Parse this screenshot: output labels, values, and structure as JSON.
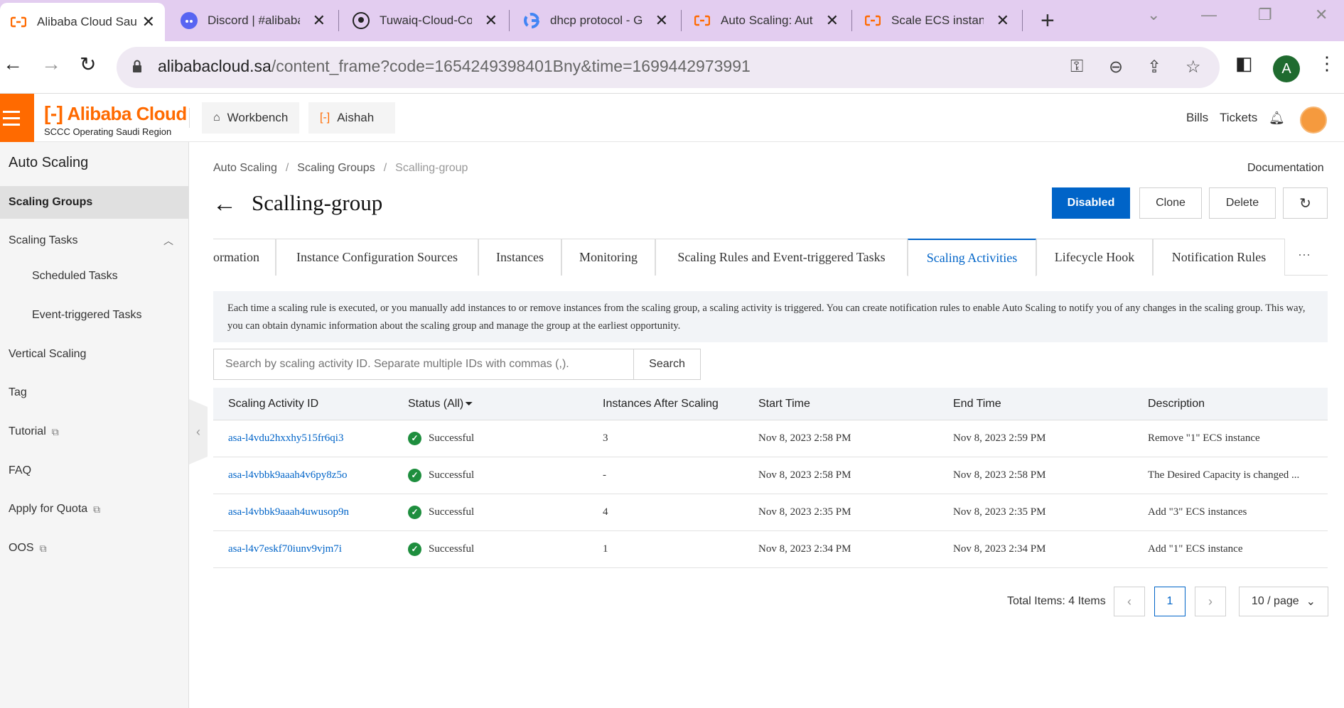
{
  "browser": {
    "tabs": [
      {
        "title": "Alibaba Cloud Sau",
        "icon": "alibaba-icon"
      },
      {
        "title": "Discord | #alibaba",
        "icon": "discord-icon"
      },
      {
        "title": "Tuwaiq-Cloud-Cor",
        "icon": "github-icon"
      },
      {
        "title": "dhcp protocol - Go",
        "icon": "google-icon"
      },
      {
        "title": "Auto Scaling: Auto",
        "icon": "alibaba-icon"
      },
      {
        "title": "Scale ECS instance",
        "icon": "alibaba-icon"
      }
    ],
    "url_domain": "alibabacloud.sa",
    "url_path": "/content_frame?code=1654249398401Bny&time=1699442973991",
    "profile_initial": "A"
  },
  "topbar": {
    "brand": "Alibaba Cloud",
    "region": "SCCC Operating Saudi Region",
    "workbench": "Workbench",
    "account": "Aishah",
    "bills": "Bills",
    "tickets": "Tickets",
    "accent": "#ff6a00"
  },
  "sidebar": {
    "title": "Auto Scaling",
    "items": [
      {
        "label": "Scaling Groups"
      },
      {
        "label": "Scaling Tasks"
      },
      {
        "label": "Scheduled Tasks"
      },
      {
        "label": "Event-triggered Tasks"
      },
      {
        "label": "Vertical Scaling"
      },
      {
        "label": "Tag"
      },
      {
        "label": "Tutorial"
      },
      {
        "label": "FAQ"
      },
      {
        "label": "Apply for Quota"
      },
      {
        "label": "OOS"
      }
    ]
  },
  "main": {
    "breadcrumb": [
      "Auto Scaling",
      "Scaling Groups",
      "Scalling-group"
    ],
    "documentation": "Documentation",
    "title": "Scalling-group",
    "buttons": {
      "disabled": "Disabled",
      "clone": "Clone",
      "delete": "Delete"
    },
    "tabs": [
      {
        "label": "ormation"
      },
      {
        "label": "Instance Configuration Sources"
      },
      {
        "label": "Instances"
      },
      {
        "label": "Monitoring"
      },
      {
        "label": "Scaling Rules and Event-triggered Tasks"
      },
      {
        "label": "Scaling Activities"
      },
      {
        "label": "Lifecycle Hook"
      },
      {
        "label": "Notification Rules"
      }
    ],
    "notice": "Each time a scaling rule is executed, or you manually add instances to or remove instances from the scaling group, a scaling activity is triggered. You can create notification rules to enable Auto Scaling to notify you of any changes in the scaling group. This way, you can obtain dynamic information about the scaling group and manage the group at the earliest opportunity.",
    "search": {
      "placeholder": "Search by scaling activity ID. Separate multiple IDs with commas (,).",
      "button": "Search"
    },
    "table": {
      "headers": [
        "Scaling Activity ID",
        "Status (All)",
        "Instances After Scaling",
        "Start Time",
        "End Time",
        "Description"
      ],
      "rows": [
        {
          "id": "asa-l4vdu2hxxhy515fr6qi3",
          "status": "Successful",
          "instances": "3",
          "start": "Nov 8, 2023 2:58 PM",
          "end": "Nov 8, 2023 2:59 PM",
          "desc": "Remove \"1\" ECS instance"
        },
        {
          "id": "asa-l4vbbk9aaah4v6py8z5o",
          "status": "Successful",
          "instances": "-",
          "start": "Nov 8, 2023 2:58 PM",
          "end": "Nov 8, 2023 2:58 PM",
          "desc": "The Desired Capacity is changed ..."
        },
        {
          "id": "asa-l4vbbk9aaah4uwusop9n",
          "status": "Successful",
          "instances": "4",
          "start": "Nov 8, 2023 2:35 PM",
          "end": "Nov 8, 2023 2:35 PM",
          "desc": "Add \"3\" ECS instances"
        },
        {
          "id": "asa-l4v7eskf70iunv9vjm7i",
          "status": "Successful",
          "instances": "1",
          "start": "Nov 8, 2023 2:34 PM",
          "end": "Nov 8, 2023 2:34 PM",
          "desc": "Add \"1\" ECS instance"
        }
      ]
    },
    "pagination": {
      "total": "Total Items: 4 Items",
      "current_page": "1",
      "page_size": "10 / page"
    }
  }
}
